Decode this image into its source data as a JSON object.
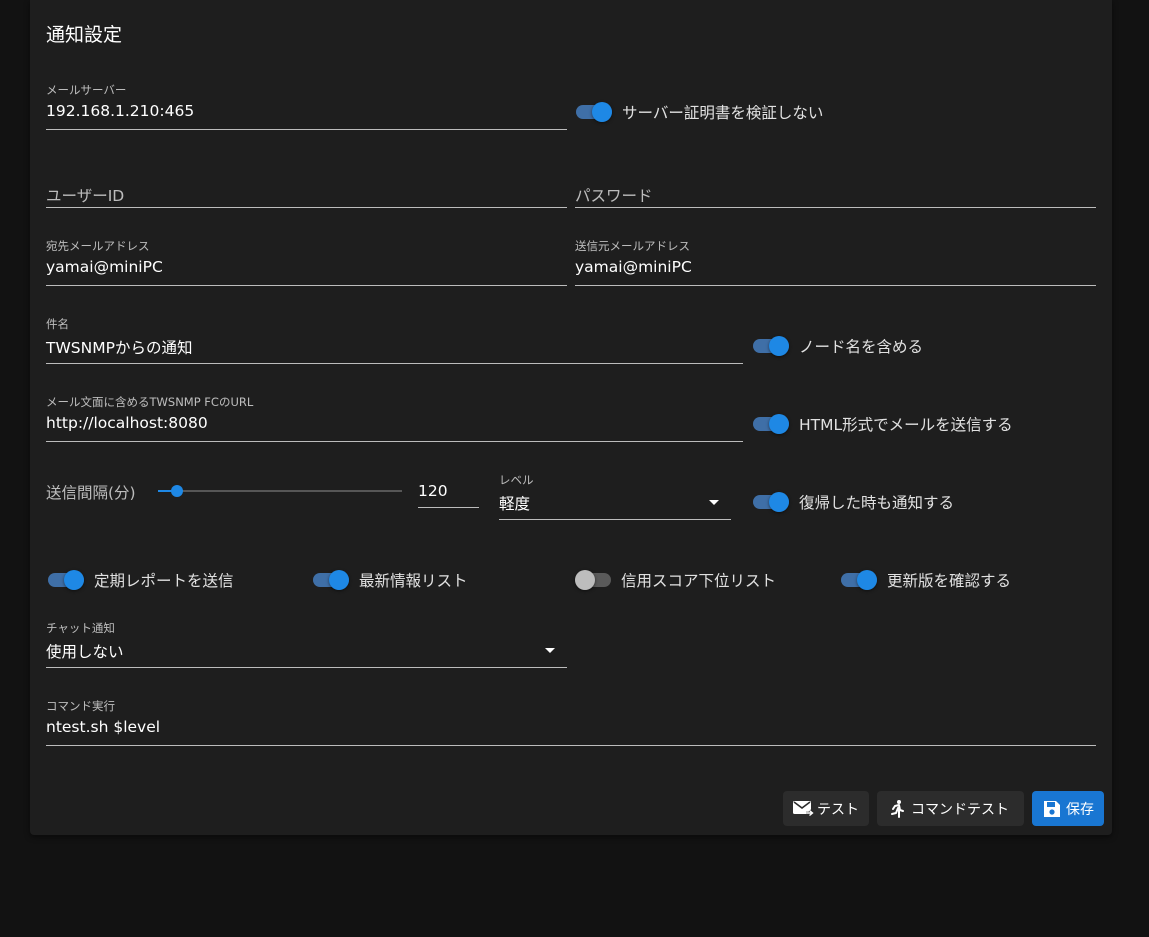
{
  "title": "通知設定",
  "mail_server": {
    "label": "メールサーバー",
    "value": "192.168.1.210:465"
  },
  "skip_verify": {
    "label": "サーバー証明書を検証しない",
    "on": true
  },
  "user_id": {
    "placeholder": "ユーザーID"
  },
  "password": {
    "placeholder": "パスワード"
  },
  "mail_to": {
    "label": "宛先メールアドレス",
    "value": "yamai@miniPC"
  },
  "mail_from": {
    "label": "送信元メールアドレス",
    "value": "yamai@miniPC"
  },
  "subject": {
    "label": "件名",
    "value": "TWSNMPからの通知"
  },
  "add_node_name": {
    "label": "ノード名を含める",
    "on": true
  },
  "url": {
    "label": "メール文面に含めるTWSNMP FCのURL",
    "value": "http://localhost:8080"
  },
  "html_mail": {
    "label": "HTML形式でメールを送信する",
    "on": true
  },
  "interval": {
    "label": "送信間隔(分)",
    "value": "120"
  },
  "level": {
    "label": "レベル",
    "value": "軽度"
  },
  "notify_repair": {
    "label": "復帰した時も通知する",
    "on": true
  },
  "toggles": [
    {
      "label": "定期レポートを送信",
      "on": true
    },
    {
      "label": "最新情報リスト",
      "on": true
    },
    {
      "label": "信用スコア下位リスト",
      "on": false
    },
    {
      "label": "更新版を確認する",
      "on": true
    }
  ],
  "chat": {
    "label": "チャット通知",
    "value": "使用しない"
  },
  "command": {
    "label": "コマンド実行",
    "value": "ntest.sh $level"
  },
  "buttons": {
    "test": "テスト",
    "command_test": "コマンドテスト",
    "save": "保存"
  },
  "colors": {
    "accent": "#1e88e5",
    "save_button": "#1976d2",
    "card": "#1e1e1e",
    "background": "#121212"
  }
}
